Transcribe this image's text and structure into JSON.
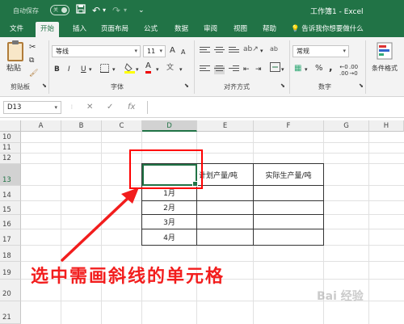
{
  "titlebar": {
    "autosave_label": "自动保存",
    "autosave_toggle": "关",
    "title": "工作簿1 - Excel"
  },
  "tabs": [
    "文件",
    "开始",
    "插入",
    "页面布局",
    "公式",
    "数据",
    "审阅",
    "视图",
    "帮助"
  ],
  "active_tab": "开始",
  "tell_me": "告诉我你想要做什么",
  "ribbon": {
    "paste_label": "粘贴",
    "groups": {
      "clipboard": "剪贴板",
      "font": "字体",
      "alignment": "对齐方式",
      "number": "数字",
      "styles": "条件格式"
    },
    "font_name": "等线",
    "font_size": "11",
    "bold": "B",
    "italic": "I",
    "underline": "U",
    "grow": "A",
    "shrink": "A",
    "font_color_letter": "A",
    "wrap": "ab",
    "number_format": "常规",
    "percent": "%",
    "comma": ","
  },
  "formula_bar": {
    "name_box": "D13",
    "fx": "fx",
    "cancel": "✕",
    "enter": "✓",
    "value": ""
  },
  "sheet": {
    "columns": [
      "A",
      "B",
      "C",
      "D",
      "E",
      "F",
      "G",
      "H"
    ],
    "selected_column": "D",
    "rows": [
      "10",
      "11",
      "12",
      "13",
      "14",
      "15",
      "16",
      "17",
      "18",
      "19",
      "20",
      "21"
    ],
    "selected_row": "13",
    "header_cells": [
      "计划产量/吨",
      "实际生产量/吨"
    ],
    "month_cells": [
      "1月",
      "2月",
      "3月",
      "4月"
    ]
  },
  "annotation": "选中需画斜线的单元格",
  "watermark": "Bai 经验",
  "colors": {
    "excel_green": "#217346",
    "annotation_red": "#f21d1d"
  }
}
